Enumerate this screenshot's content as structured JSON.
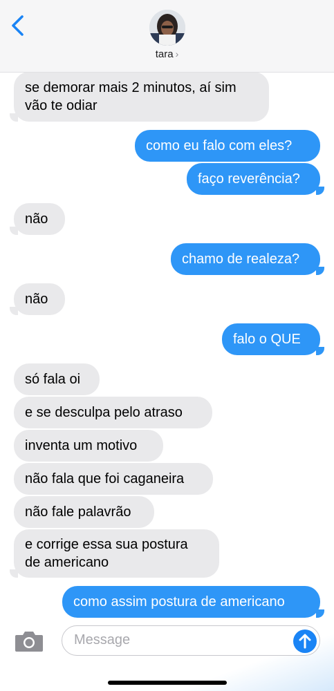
{
  "header": {
    "contact_name": "tara",
    "chevron": "›",
    "back_icon": "chevron-left-icon"
  },
  "messages": [
    {
      "side": "in",
      "text_lines": [
        "se demorar mais 2 minutos, aí sim",
        "vão te odiar"
      ]
    },
    {
      "side": "out",
      "text": "como eu falo com eles?"
    },
    {
      "side": "out",
      "text": "faço reverência?"
    },
    {
      "side": "in",
      "text": "não"
    },
    {
      "side": "out",
      "text": "chamo de realeza?"
    },
    {
      "side": "in",
      "text": "não"
    },
    {
      "side": "out",
      "text": "falo o QUE"
    },
    {
      "side": "in",
      "text": "só fala oi"
    },
    {
      "side": "in",
      "text": "e se desculpa pelo atraso"
    },
    {
      "side": "in",
      "text": "inventa um motivo"
    },
    {
      "side": "in",
      "text": "não fala que foi caganeira"
    },
    {
      "side": "in",
      "text": "não fale palavrão"
    },
    {
      "side": "in",
      "text_lines": [
        "e corrige essa sua postura",
        "de americano"
      ]
    },
    {
      "side": "out",
      "text": "como assim postura de americano"
    }
  ],
  "compose": {
    "placeholder": "Message",
    "camera_icon": "camera-icon",
    "send_icon": "arrow-up-icon"
  },
  "colors": {
    "outgoing": "#2e96f7",
    "incoming": "#e9e9eb",
    "send": "#1a84f5"
  }
}
